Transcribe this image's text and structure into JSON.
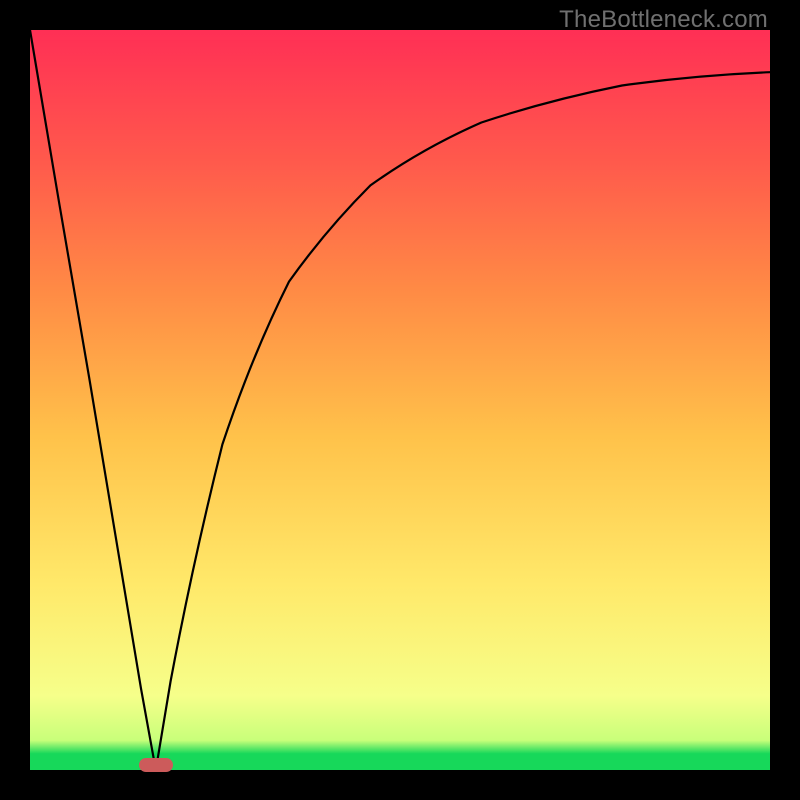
{
  "watermark": {
    "text": "TheBottleneck.com"
  },
  "colors": {
    "frame": "#000000",
    "gradient_top": "#ff2f55",
    "gradient_upper": "#ff8a45",
    "gradient_mid": "#ffe96a",
    "gradient_lower": "#f6ff8a",
    "gradient_bottom_band": "#17d85a",
    "curve": "#000000",
    "marker": "#cc5b5b"
  },
  "chart_data": {
    "type": "line",
    "title": "",
    "xlabel": "",
    "ylabel": "",
    "xlim": [
      0,
      100
    ],
    "ylim": [
      0,
      100
    ],
    "grid": false,
    "legend": false,
    "annotations": [
      {
        "kind": "marker",
        "x": 17,
        "y": 0,
        "shape": "pill",
        "color": "#cc5b5b"
      },
      {
        "kind": "watermark",
        "text": "TheBottleneck.com",
        "position": "top-right"
      }
    ],
    "series": [
      {
        "name": "left-leg",
        "x": [
          0,
          4,
          8,
          12,
          15,
          17
        ],
        "y": [
          100,
          76,
          53,
          29,
          11,
          0
        ]
      },
      {
        "name": "right-curve",
        "x": [
          17,
          19,
          22,
          26,
          30,
          35,
          40,
          46,
          53,
          61,
          70,
          80,
          90,
          100
        ],
        "y": [
          0,
          12,
          28,
          44,
          56,
          66,
          73,
          79,
          84,
          87.5,
          90,
          92,
          93.3,
          94.3
        ]
      }
    ],
    "minimum_point": {
      "x": 17,
      "y": 0
    }
  }
}
